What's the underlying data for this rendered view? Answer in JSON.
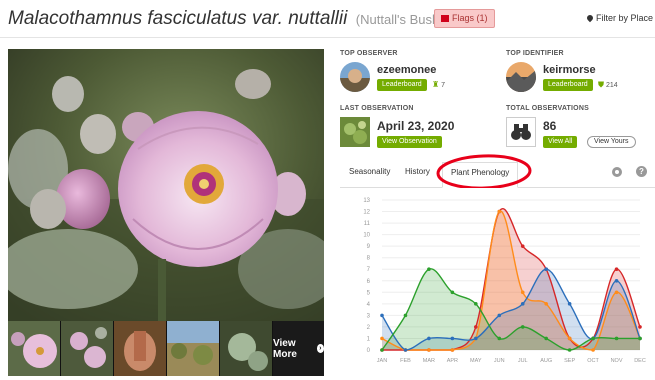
{
  "header": {
    "scientific_name": "Malacothamnus fasciculatus var. nuttallii",
    "common_name": "(Nuttall's Bush-Mallow)",
    "flags_label": "Flags (1)",
    "filter_label": "Filter by Place"
  },
  "photos": {
    "view_more_label": "View More"
  },
  "stats": {
    "top_observer": {
      "label": "TOP OBSERVER",
      "username": "ezeemonee",
      "leaderboard_label": "Leaderboard",
      "count": "7"
    },
    "top_identifier": {
      "label": "TOP IDENTIFIER",
      "username": "keirmorse",
      "leaderboard_label": "Leaderboard",
      "count": "214"
    },
    "last_observation": {
      "label": "LAST OBSERVATION",
      "date": "April 23, 2020",
      "button_label": "View Observation"
    },
    "total_observations": {
      "label": "TOTAL OBSERVATIONS",
      "value": "86",
      "view_all_label": "View All",
      "view_yours_label": "View Yours"
    }
  },
  "tabs": [
    {
      "label": "Seasonality",
      "active": false
    },
    {
      "label": "History",
      "active": false
    },
    {
      "label": "Plant Phenology",
      "active": true
    }
  ],
  "colors": {
    "accent_green": "#74ac00",
    "annotation_red": "#e8001a"
  },
  "chart_data": {
    "type": "area",
    "y_ticks": [
      "0",
      "1",
      "2",
      "3",
      "4",
      "5",
      "6",
      "7",
      "8",
      "9",
      "10",
      "11",
      "12",
      "13"
    ],
    "ylim": [
      0,
      13
    ],
    "categories": [
      "JAN",
      "FEB",
      "MAR",
      "APR",
      "MAY",
      "JUN",
      "JUL",
      "AUG",
      "SEP",
      "OCT",
      "NOV",
      "DEC"
    ],
    "grid": true,
    "series": [
      {
        "color": "#d62728",
        "values": [
          0,
          0,
          0,
          0,
          2,
          12,
          9,
          7,
          1,
          1,
          7,
          2
        ]
      },
      {
        "color": "#ff8c1a",
        "values": [
          1,
          0,
          0,
          0,
          1,
          12,
          5,
          4,
          1,
          0,
          5,
          1
        ]
      },
      {
        "color": "#2c6fbb",
        "values": [
          3,
          0,
          1,
          1,
          1,
          3,
          4,
          7,
          4,
          1,
          6,
          1
        ]
      },
      {
        "color": "#2ca02c",
        "values": [
          0,
          3,
          7,
          5,
          4,
          1,
          2,
          1,
          0,
          1,
          1,
          1
        ]
      }
    ]
  }
}
